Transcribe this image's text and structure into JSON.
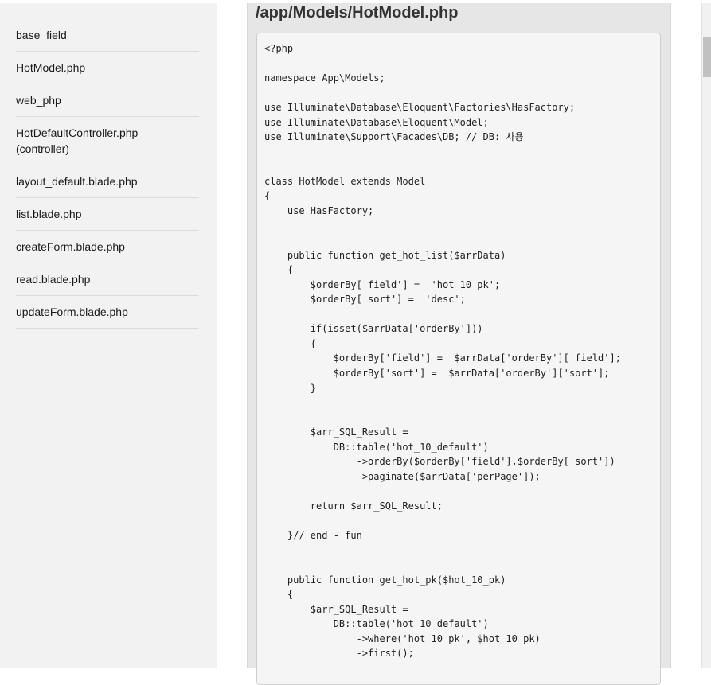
{
  "sidebar": {
    "items": [
      {
        "label": "base_field"
      },
      {
        "label": "HotModel.php"
      },
      {
        "label": "web_php"
      },
      {
        "label": "HotDefaultController.php (controller)",
        "line1": "HotDefaultController.php",
        "line2": "(controller)"
      },
      {
        "label": "layout_default.blade.php"
      },
      {
        "label": "list.blade.php"
      },
      {
        "label": "createForm.blade.php"
      },
      {
        "label": "read.blade.php"
      },
      {
        "label": "updateForm.blade.php"
      }
    ]
  },
  "main": {
    "title": "/app/Models/HotModel.php",
    "code": "<?php\n\nnamespace App\\Models;\n\nuse Illuminate\\Database\\Eloquent\\Factories\\HasFactory;\nuse Illuminate\\Database\\Eloquent\\Model;\nuse Illuminate\\Support\\Facades\\DB; // DB: 사용\n\n\nclass HotModel extends Model\n{\n    use HasFactory;\n\n\n    public function get_hot_list($arrData)\n    {\n        $orderBy['field'] =  'hot_10_pk';\n        $orderBy['sort'] =  'desc';\n\n        if(isset($arrData['orderBy']))\n        {\n            $orderBy['field'] =  $arrData['orderBy']['field'];\n            $orderBy['sort'] =  $arrData['orderBy']['sort'];\n        }\n\n\n        $arr_SQL_Result =\n            DB::table('hot_10_default')\n                ->orderBy($orderBy['field'],$orderBy['sort'])\n                ->paginate($arrData['perPage']);\n\n        return $arr_SQL_Result;\n\n    }// end - fun\n\n\n    public function get_hot_pk($hot_10_pk)\n    {\n        $arr_SQL_Result =\n            DB::table('hot_10_default')\n                ->where('hot_10_pk', $hot_10_pk)\n                ->first();"
  }
}
